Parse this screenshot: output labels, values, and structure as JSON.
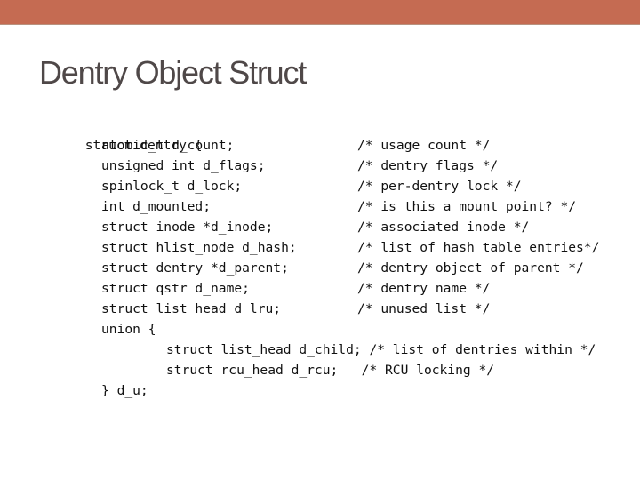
{
  "slide": {
    "title": "Dentry Object Struct",
    "accent_color": "#c56b52"
  },
  "code": {
    "opening": "struct dentry {",
    "fields": [
      {
        "decl": "atomic_t d_count;",
        "comment": "/* usage count */"
      },
      {
        "decl": "unsigned int d_flags;",
        "comment": "/* dentry flags */"
      },
      {
        "decl": "spinlock_t d_lock;",
        "comment": "/* per-dentry lock */"
      },
      {
        "decl": "int d_mounted;",
        "comment": "/* is this a mount point? */"
      },
      {
        "decl": "struct inode *d_inode;",
        "comment": "/* associated inode */"
      },
      {
        "decl": "struct hlist_node d_hash;",
        "comment": "/* list of hash table entries*/"
      },
      {
        "decl": "struct dentry *d_parent;",
        "comment": "/* dentry object of parent */"
      },
      {
        "decl": "struct qstr d_name;",
        "comment": "/* dentry name */"
      },
      {
        "decl": "struct list_head d_lru;",
        "comment": "/* unused list */"
      }
    ],
    "union_open": "union {",
    "union_fields": [
      "struct list_head d_child; /* list of dentries within */",
      "struct rcu_head d_rcu;   /* RCU locking */"
    ],
    "union_close": "} d_u;"
  }
}
